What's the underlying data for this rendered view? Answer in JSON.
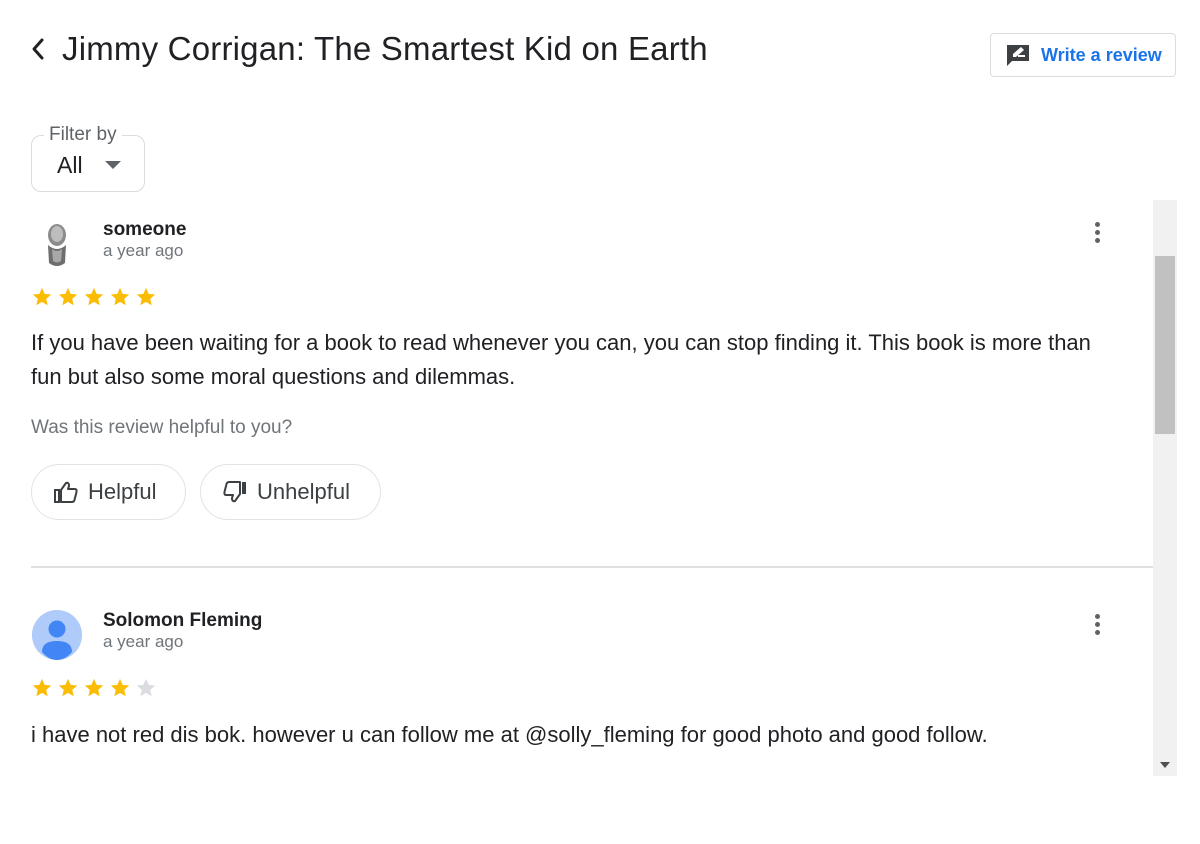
{
  "header": {
    "title": "Jimmy Corrigan: The Smartest Kid on Earth",
    "write_review_label": "Write a review"
  },
  "filter": {
    "legend": "Filter by",
    "selected": "All"
  },
  "reviews": [
    {
      "author": "someone",
      "time": "a year ago",
      "rating": 5,
      "text": "If you have been waiting for a book to read whenever you can, you can stop finding it. This book is more than fun but also some moral questions and dilemmas.",
      "helpful_question": "Was this review helpful to you?",
      "helpful_label": "Helpful",
      "unhelpful_label": "Unhelpful"
    },
    {
      "author": "Solomon Fleming",
      "time": "a year ago",
      "rating": 4,
      "text": "i have not red dis bok. however u can follow me at @solly_fleming for good photo and good follow."
    }
  ],
  "colors": {
    "star_filled": "#fbbc04",
    "star_empty": "#dadce0",
    "accent": "#1a73e8",
    "avatar_default_bg": "#aecbfa",
    "avatar_default_fg": "#4285f4"
  },
  "icons": {
    "back": "chevron-left-icon",
    "write": "rate-review-icon",
    "dropdown": "caret-down-icon",
    "more": "more-vert-icon",
    "thumb_up": "thumb-up-icon",
    "thumb_down": "thumb-down-icon"
  }
}
